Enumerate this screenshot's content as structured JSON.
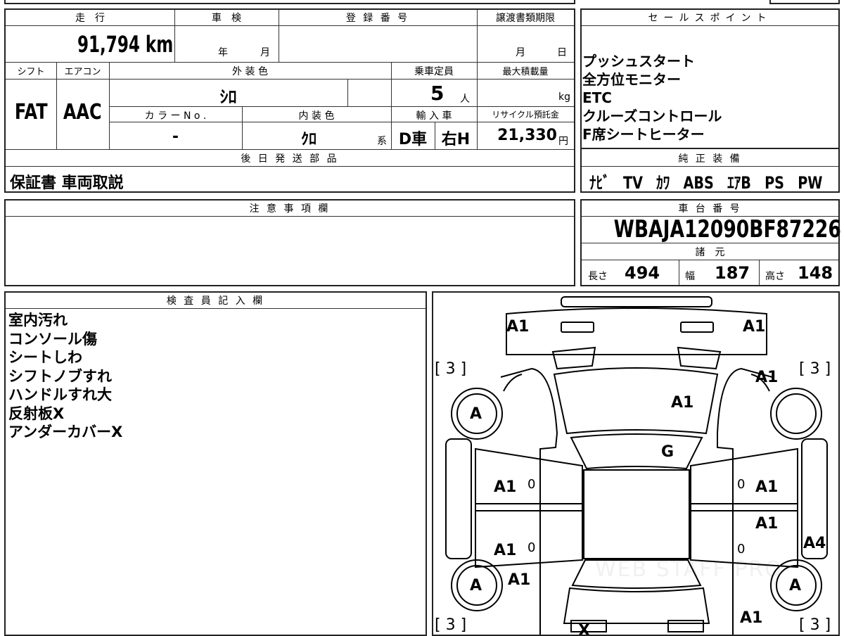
{
  "top_info": {
    "headers": {
      "mileage": "走　行",
      "inspection": "車　検",
      "registration": "登 録 番 号",
      "transfer_deadline": "譲渡書類期限",
      "sales_points": "セールスポイント"
    },
    "mileage_value": "91,794 km",
    "inspection_year_unit": "年",
    "inspection_month_unit": "月",
    "transfer_month_unit": "月",
    "transfer_day_unit": "日",
    "headers2": {
      "shift": "シフト",
      "aircon": "エアコン",
      "exterior_color": "外 装 色",
      "capacity": "乗車定員",
      "max_load": "最大積載量",
      "color_no": "カ ラ ー N o .",
      "interior_color": "内 装 色",
      "import": "輸 入 車",
      "recycle": "リサイクル預託金"
    },
    "shift_value": "FAT",
    "aircon_value": "AAC",
    "exterior_color_value": "ｼﾛ",
    "capacity_value": "5",
    "capacity_unit": "人",
    "max_load_unit": "kg",
    "color_no_value": "-",
    "interior_color_value": "ｸﾛ",
    "interior_suffix": "系",
    "import_value_1": "D車",
    "import_value_2": "右H",
    "recycle_value": "21,330",
    "recycle_unit": "円",
    "later_parts_header": "後 日 発 送 部 品",
    "later_parts_value": "保証書 車両取説"
  },
  "sales_points": {
    "items": [
      "プッシュスタート",
      "全方位モニター",
      "ETC",
      "クルーズコントロール",
      "F席シートヒーター"
    ]
  },
  "equipment": {
    "header": "純 正 装 備",
    "value": "ﾅﾋﾞ　TV　ｶﾜ　ABS　ｴｱB　PS　PW"
  },
  "notes": {
    "header": "注 意 事 項 欄",
    "value": ""
  },
  "chassis": {
    "header": "車 台 番 号",
    "value": "WBAJA12090BF87226",
    "spec_header": "諸　元",
    "length_label": "長さ",
    "length_value": "494",
    "width_label": "幅",
    "width_value": "187",
    "height_label": "高さ",
    "height_value": "148"
  },
  "inspector": {
    "header": "検 査 員 記 入 欄",
    "lines": [
      "室内汚れ",
      "コンソール傷",
      "シートしわ",
      "シフトノブすれ",
      "ハンドルすれ大",
      "反射板X",
      "アンダーカバーX"
    ]
  },
  "diagram": {
    "marks": {
      "front_left": "A1",
      "front_right": "A1",
      "tire_fl_bracket": "[ 3 ]",
      "tire_fr_bracket": "[ 3 ]",
      "tire_rl_bracket": "[ 3 ]",
      "tire_rr_bracket": "[ 3 ]",
      "fender_fr": "A1",
      "hood": "A1",
      "windshield": "G",
      "wheel_fl": "A",
      "wheel_rl": "A",
      "wheel_rr": "A",
      "door_fl": "A1",
      "door_rl": "A1",
      "door_fr": "A1",
      "door_rr": "A1",
      "door_rr2": "A1",
      "fender_rl": "A1",
      "fender_rr": "A1",
      "rocker_r": "A4",
      "zero_fl": "0",
      "zero_rl": "0",
      "zero_fr": "0",
      "zero_rr": "0",
      "rear_x": "X"
    },
    "watermark": "WEB STAFF PRO"
  }
}
